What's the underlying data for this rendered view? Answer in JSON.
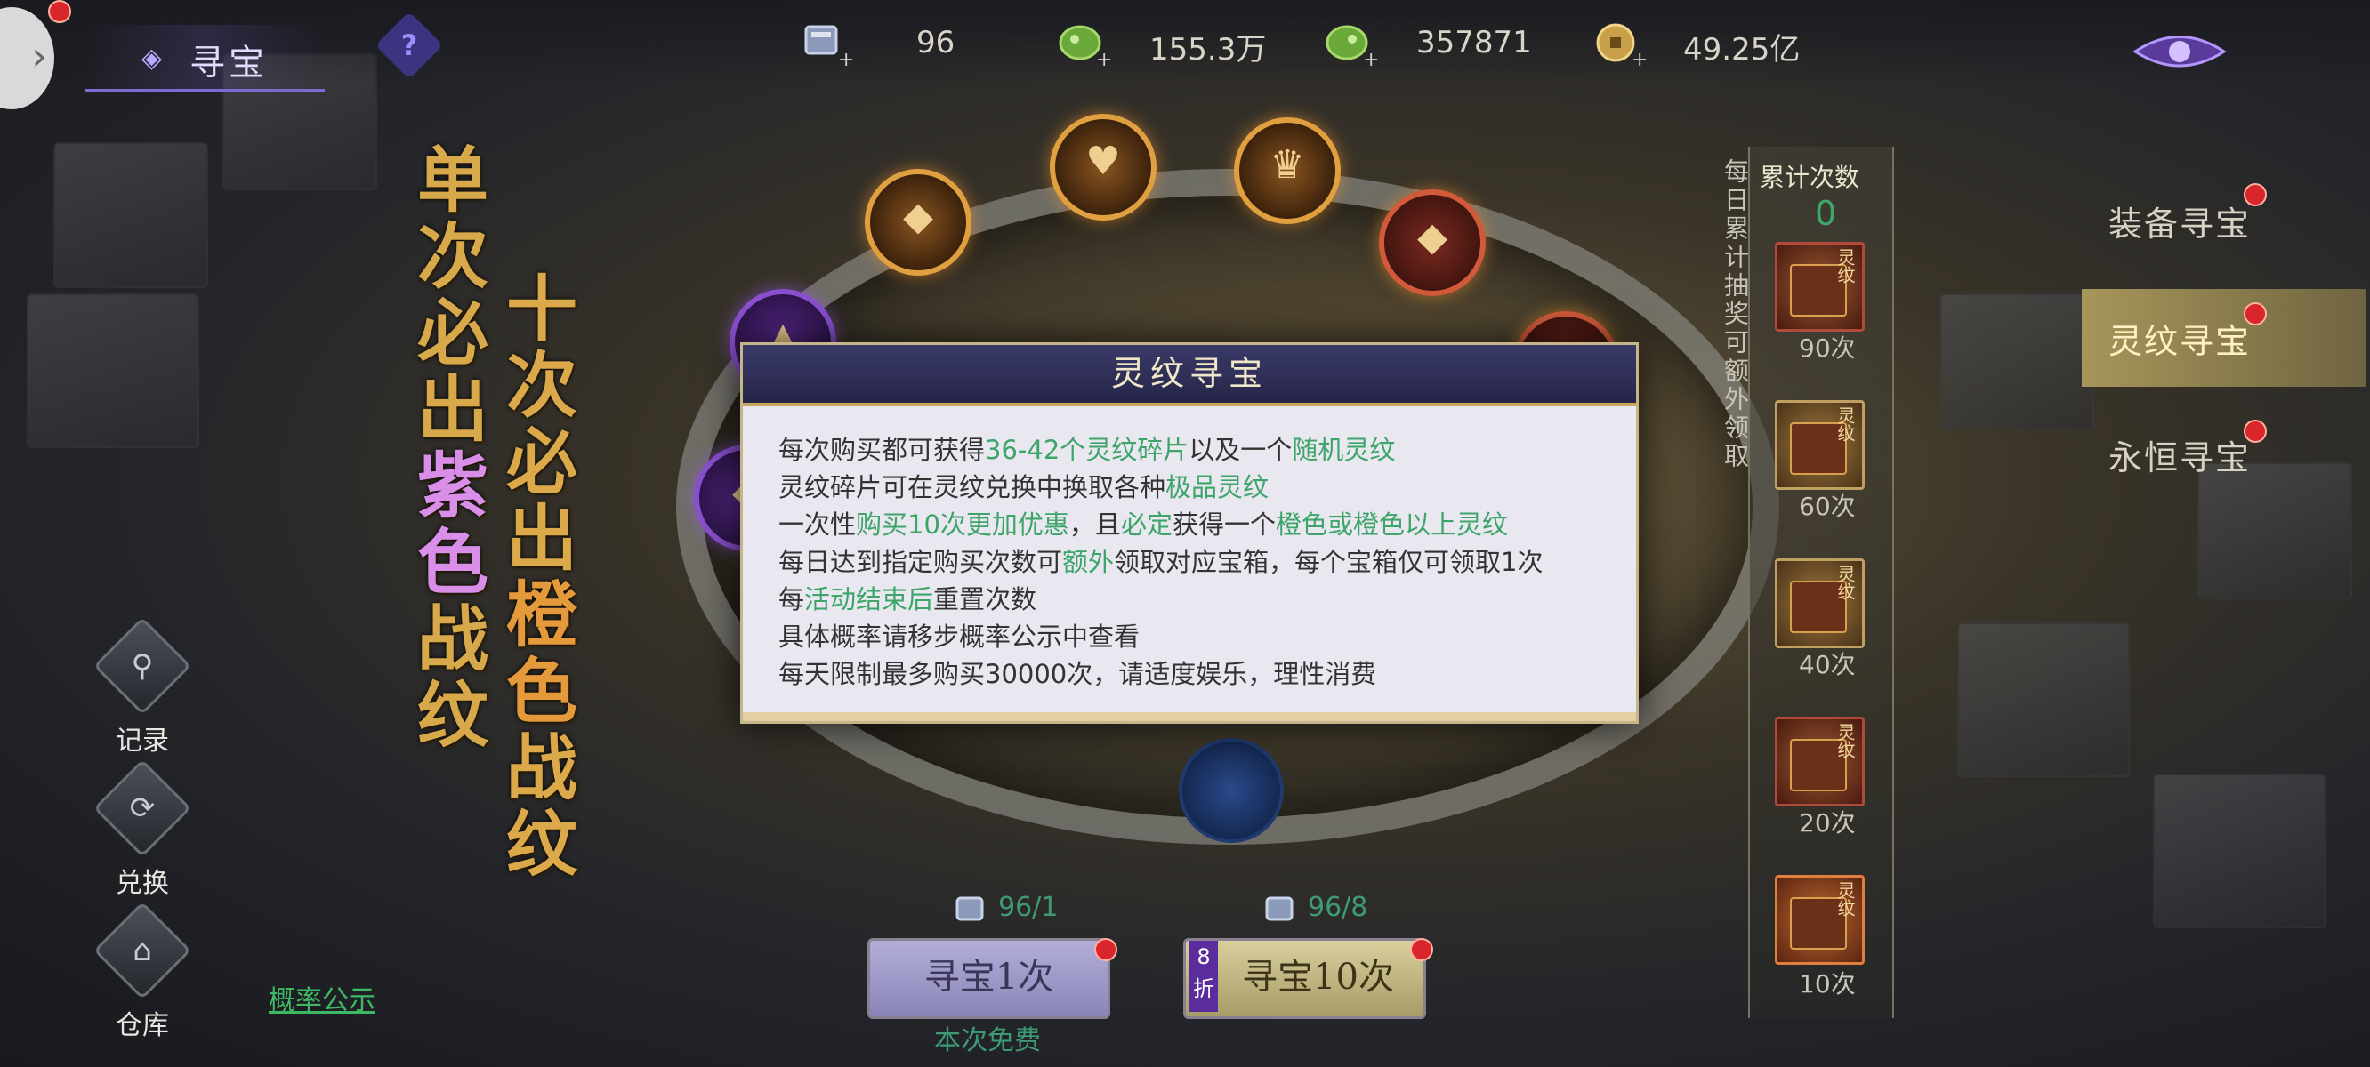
{
  "header": {
    "title": "寻宝",
    "help": "?",
    "resources": [
      {
        "icon": "scroll-ticket-icon",
        "value": "96"
      },
      {
        "icon": "green-jade-icon",
        "value": "155.3万"
      },
      {
        "icon": "green-jade-bound-icon",
        "value": "357871"
      },
      {
        "icon": "gold-coin-icon",
        "value": "49.25亿"
      }
    ]
  },
  "banner": {
    "col_a": [
      "单次必出",
      "紫色",
      "战纹"
    ],
    "col_b": [
      "十次必出",
      "橙色",
      "战纹"
    ]
  },
  "left_menu": [
    {
      "label": "记录",
      "glyph": "⚲"
    },
    {
      "label": "兑换",
      "glyph": "⟳"
    },
    {
      "label": "仓库",
      "glyph": "⌂"
    }
  ],
  "prob_link": "概率公示",
  "dialog": {
    "title": "灵纹寻宝",
    "lines": [
      [
        {
          "t": "每次购买都可获得"
        },
        {
          "t": "36-42个灵纹碎片",
          "h": true
        },
        {
          "t": "以及一个"
        },
        {
          "t": "随机灵纹",
          "h": true
        }
      ],
      [
        {
          "t": "灵纹碎片可在灵纹兑换中换取各种"
        },
        {
          "t": "极品灵纹",
          "h": true
        }
      ],
      [
        {
          "t": "一次性"
        },
        {
          "t": "购买10次更加优惠",
          "h": true
        },
        {
          "t": "，且"
        },
        {
          "t": "必定",
          "h": true
        },
        {
          "t": "获得一个"
        },
        {
          "t": "橙色或橙色以上灵纹",
          "h": true
        }
      ],
      [
        {
          "t": "每日达到指定购买次数可"
        },
        {
          "t": "额外",
          "h": true
        },
        {
          "t": "领取对应宝箱，每个宝箱仅可领取1次"
        }
      ],
      [
        {
          "t": "每"
        },
        {
          "t": "活动结束后",
          "h": true
        },
        {
          "t": "重置次数"
        }
      ],
      [
        {
          "t": "具体概率请移步概率公示中查看"
        }
      ],
      [
        {
          "t": "每天限制最多购买30000次，请适度娱乐，理性消费"
        }
      ]
    ]
  },
  "buy": {
    "single": {
      "cost": "96/1",
      "label": "寻宝1次",
      "note": "本次免费"
    },
    "ten": {
      "cost": "96/8",
      "label": "寻宝10次",
      "discount": "8折"
    }
  },
  "tracker": {
    "side_text": "每日累计抽奖可额外领取",
    "head": "累计次数",
    "count": "0",
    "chest_tag": "灵纹",
    "milestones": [
      "90次",
      "60次",
      "40次",
      "20次",
      "10次"
    ]
  },
  "tabs": [
    {
      "label": "装备寻宝",
      "active": false
    },
    {
      "label": "灵纹寻宝",
      "active": true
    },
    {
      "label": "永恒寻宝",
      "active": false
    }
  ],
  "colors": {
    "highlight": "#3da56a",
    "accent": "#7c6bd0",
    "red_dot": "#d8262a"
  }
}
